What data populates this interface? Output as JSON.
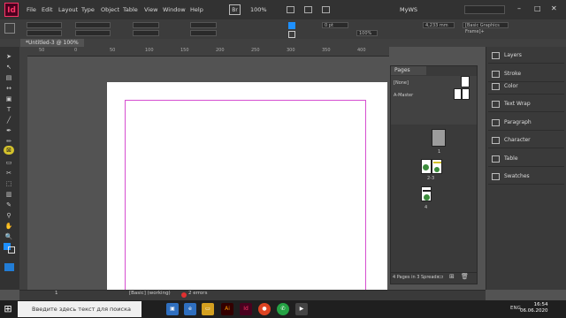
{
  "app": {
    "icon_label": "Id",
    "workspace": "MyWS",
    "zoom": "100%",
    "bridge_label": "Br"
  },
  "menu": [
    "File",
    "Edit",
    "Layout",
    "Type",
    "Object",
    "Table",
    "View",
    "Window",
    "Help"
  ],
  "control": {
    "stroke_weight": "0 pt",
    "zoom_field": "100%",
    "frame_style": "[Basic Graphics Frame]+",
    "width_value": "4,233 mm"
  },
  "document": {
    "tab_title": "*Untitled-3 @ 100%"
  },
  "ruler": {
    "ticks": [
      "50",
      "0",
      "50",
      "100",
      "150",
      "200",
      "250",
      "300",
      "350",
      "400"
    ]
  },
  "pages_panel": {
    "title": "Pages",
    "masters": [
      "[None]",
      "A-Master"
    ],
    "page_labels": [
      "1",
      "2-3",
      "4"
    ],
    "footer_text": "4 Pages in 3 Spreads"
  },
  "dock": [
    "Layers",
    "Stroke",
    "Color",
    "Text Wrap",
    "Paragraph",
    "Character",
    "Table",
    "Swatches"
  ],
  "status": {
    "page": "1",
    "style": "[Basic] (working)",
    "errors": "2 errors"
  },
  "taskbar": {
    "search_placeholder": "Введите здесь текст для поиска",
    "lang": "ENG",
    "time": "16:54",
    "date": "06.06.2020"
  },
  "colors": {
    "accent": "#ff3366",
    "margin_guide": "#d64fd0",
    "selection": "#d4c22c"
  }
}
